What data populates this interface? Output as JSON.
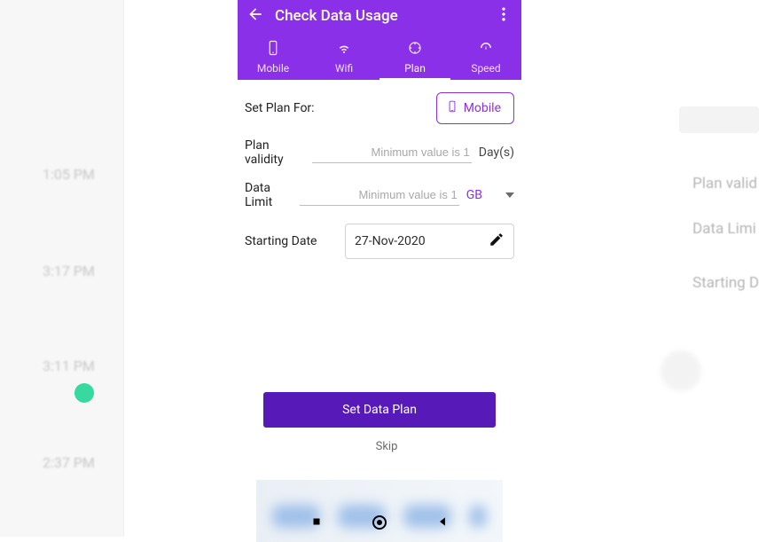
{
  "appbar": {
    "title": "Check Data Usage"
  },
  "tabs": [
    {
      "key": "mobile",
      "label": "Mobile",
      "active": false
    },
    {
      "key": "wifi",
      "label": "Wifi",
      "active": false
    },
    {
      "key": "plan",
      "label": "Plan",
      "active": true
    },
    {
      "key": "speed",
      "label": "Speed",
      "active": false
    }
  ],
  "form": {
    "setPlanFor_label": "Set Plan For:",
    "mobile_button": "Mobile",
    "validity_label": "Plan validity",
    "validity_placeholder": "Minimum value is 1",
    "validity_unit": "Day(s)",
    "dataLimit_label": "Data Limit",
    "dataLimit_placeholder": "Minimum value is 1",
    "dataLimit_unit": "GB",
    "startingDate_label": "Starting Date",
    "startingDate_value": "27-Nov-2020"
  },
  "actions": {
    "setPlan": "Set Data Plan",
    "skip": "Skip"
  },
  "bg_left_times": [
    "1:05 PM",
    "3:17 PM",
    "3:11 PM",
    "2:37 PM"
  ],
  "bg_right_labels": [
    "Plan valid",
    "Data Limi",
    "Starting D"
  ]
}
